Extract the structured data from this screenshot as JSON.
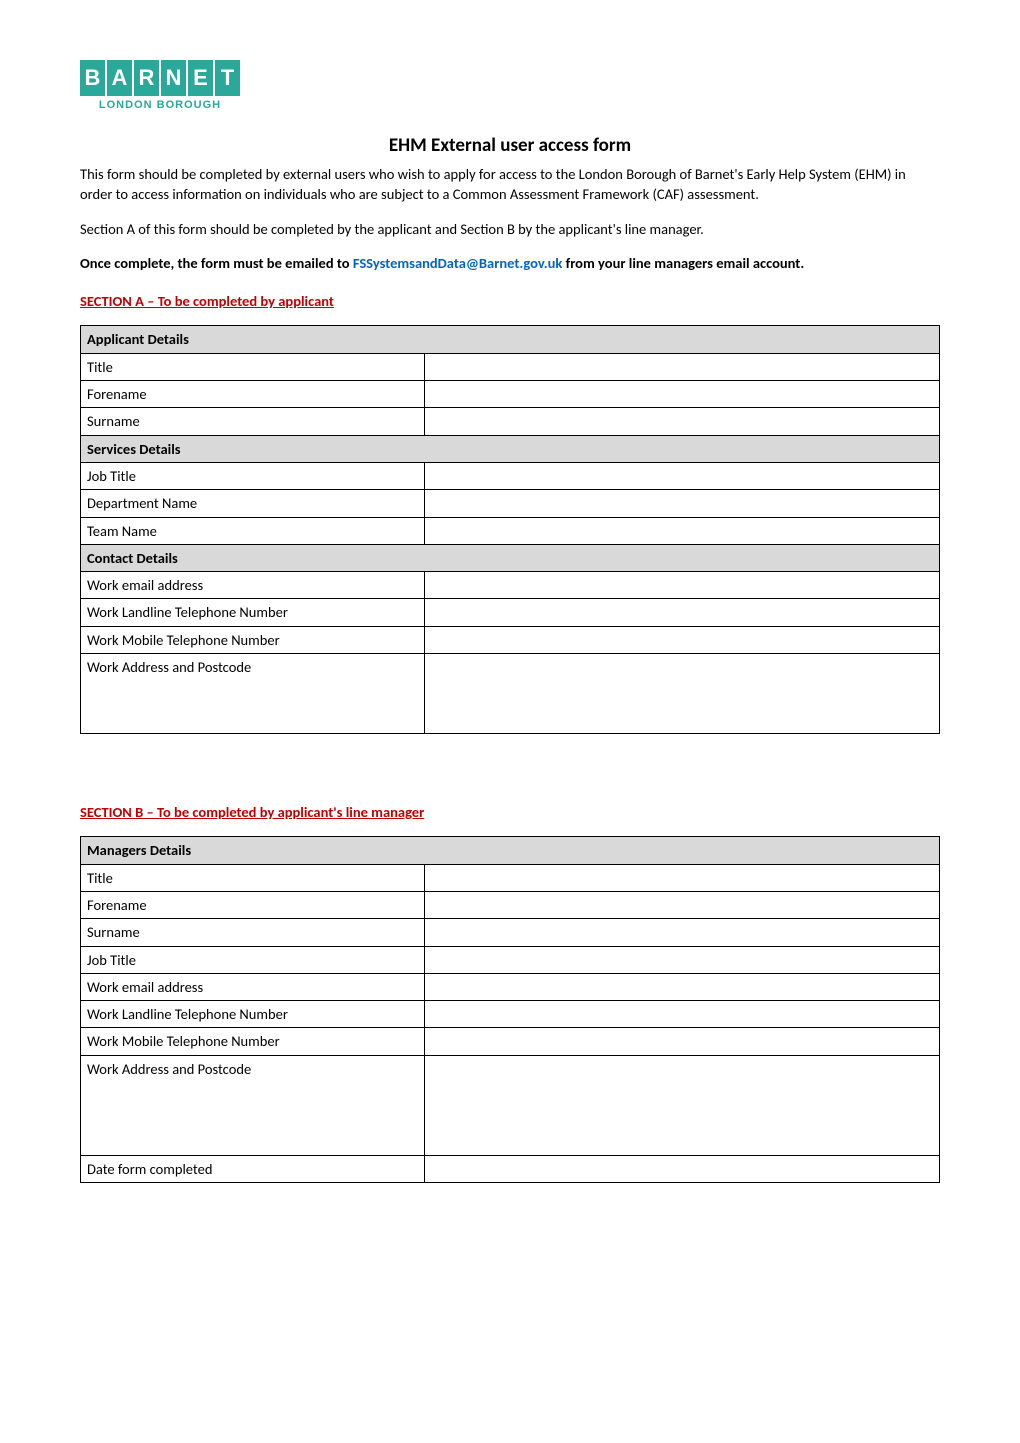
{
  "logo": {
    "letters": [
      "B",
      "A",
      "R",
      "N",
      "E",
      "T"
    ],
    "subtitle": "LONDON BOROUGH"
  },
  "title": "EHM External user access form",
  "intro": {
    "p1": "This form should be completed by external users who wish to apply for access to the London Borough of Barnet's Early Help System (EHM) in order to access information on individuals who are subject to a Common Assessment Framework  (CAF) assessment.",
    "p2": "Section A of this form should be completed by the applicant and Section B by the applicant's line manager.",
    "p3_bold_pre": "Once complete, the form must be emailed to ",
    "p3_email": "FSSystemsandData@Barnet.gov.uk",
    "p3_bold_post": " from your line managers email account."
  },
  "sectionA": {
    "header": "SECTION A – To be completed by applicant",
    "groups": [
      {
        "title": "Applicant Details",
        "rows": [
          {
            "label": "Title",
            "value": ""
          },
          {
            "label": "Forename",
            "value": ""
          },
          {
            "label": "Surname",
            "value": ""
          }
        ]
      },
      {
        "title": "Services Details",
        "rows": [
          {
            "label": "Job Title",
            "value": ""
          },
          {
            "label": "Department Name",
            "value": ""
          },
          {
            "label": "Team  Name",
            "value": ""
          }
        ]
      },
      {
        "title": "Contact Details",
        "rows": [
          {
            "label": "Work email address",
            "value": ""
          },
          {
            "label": "Work Landline Telephone Number",
            "value": ""
          },
          {
            "label": "Work Mobile Telephone Number",
            "value": ""
          },
          {
            "label": "Work Address and Postcode",
            "value": "",
            "tall": true
          }
        ]
      }
    ]
  },
  "sectionB": {
    "header": "SECTION B – To be completed by applicant's line manager",
    "groups": [
      {
        "title": "Managers Details",
        "rows": [
          {
            "label": "Title",
            "value": ""
          },
          {
            "label": "Forename",
            "value": ""
          },
          {
            "label": "Surname",
            "value": ""
          },
          {
            "label": "Job Title",
            "value": ""
          },
          {
            "label": "Work email address",
            "value": ""
          },
          {
            "label": "Work Landline Telephone Number",
            "value": ""
          },
          {
            "label": "Work Mobile Telephone Number",
            "value": ""
          },
          {
            "label": "Work Address and Postcode",
            "value": "",
            "tall2": true
          },
          {
            "label": "Date form completed",
            "value": ""
          }
        ]
      }
    ]
  }
}
